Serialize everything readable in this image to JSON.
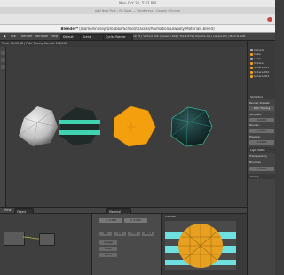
{
  "system": {
    "clock": "Mon Oct 26,  5:21 PM"
  },
  "browser": {
    "title": "Add New Post ‹ PA Sage — WordPress - Google Chrome"
  },
  "blender": {
    "title_prefix": "Blender*",
    "title_path": "[/home/lindsey/Dropbox/School/Classes/Animation/Lowpoly/Materials.blend]"
  },
  "menubar": {
    "items": [
      "File",
      "Render",
      "Window",
      "Help"
    ],
    "layout": "Default",
    "scene": "Scene",
    "engine": "Cycles Render",
    "stats": "v2.75 | Verts:2,536 | Faces:2,494 | Tris:4,874 | Objects:1/9 | Lamps:0/3 | Mem:8.20M"
  },
  "viewport": {
    "info": "Time: 00:00.38 | Path Tracing Sample 100/100"
  },
  "outliner": {
    "items": [
      "Camera",
      "Cube",
      "Lamp",
      "Sphere",
      "Sphere.001",
      "Sphere.002",
      "Sphere.003"
    ]
  },
  "properties": {
    "rows": [
      "Sampling",
      "Render Presets",
      "Path Tracing",
      "Samples:",
      "Render:",
      "Preview:",
      "Light Paths",
      "Transparency",
      "Bounces",
      "Clamp"
    ],
    "values": [
      "0.1000",
      "0.1000",
      "0.1000",
      "0.1000"
    ]
  },
  "midbar": {
    "view_label": "View",
    "mode": "Object",
    "node_label": "Material"
  },
  "texture_panel": {
    "tabs": [
      "Tex",
      "Col",
      "Flat",
      "Blend"
    ],
    "buttons": [
      "Image",
      "Color",
      "Blend"
    ],
    "fields": [
      "X: 0.000",
      "Y: 0.000"
    ]
  },
  "preview": {
    "label": "Preview"
  }
}
